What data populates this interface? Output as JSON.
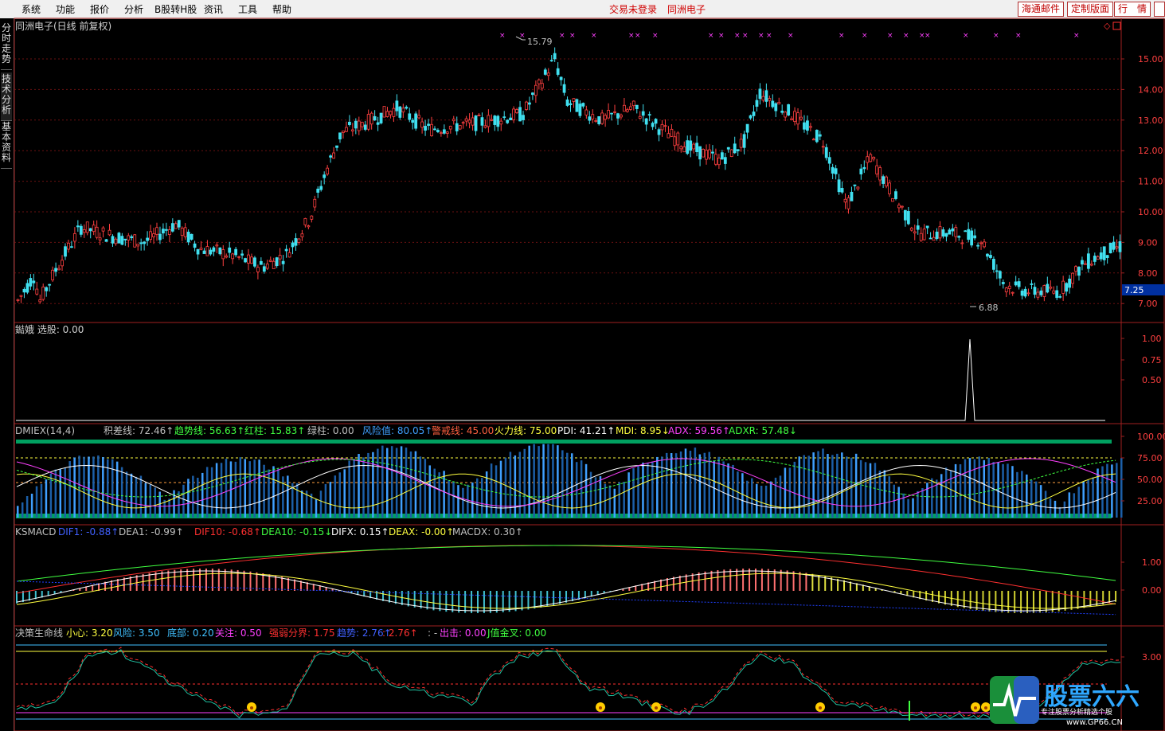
{
  "menu": [
    "系统",
    "功能",
    "报价",
    "分析",
    "B股转H股",
    "资讯",
    "工具",
    "帮助"
  ],
  "status": {
    "login": "交易未登录",
    "stock": "同洲电子"
  },
  "toolbar_buttons": [
    "海通邮件",
    "定制版面",
    "行　情"
  ],
  "side_tabs": [
    "分时走势",
    "技术分析",
    "基本资料"
  ],
  "price_panel": {
    "title": "同洲电子(日线 前复权)",
    "y_ticks": [
      "15.00",
      "14.00",
      "13.00",
      "12.00",
      "11.00",
      "10.00",
      "9.00",
      "8.00",
      "7.00"
    ],
    "high_label": "15.79",
    "low_label": "6.88",
    "current_price": "7.25"
  },
  "signal_panel": {
    "title": "鐑娥 选股: 0.00",
    "y_ticks": [
      "1.00",
      "0.75",
      "0.50"
    ]
  },
  "dmi_panel": {
    "header": [
      {
        "text": "DMIEX(14,4)",
        "color": "#c0c0c0"
      },
      {
        "text": "积差线: 72.46↑",
        "color": "#c0c0c0"
      },
      {
        "text": "趋势线: 56.63↑",
        "color": "#40ff40"
      },
      {
        "text": "红柱: 15.83↑",
        "color": "#40ff40"
      },
      {
        "text": "绿柱: 0.00",
        "color": "#c0c0c0"
      },
      {
        "text": "风险值: 80.05↑",
        "color": "#40a0ff"
      },
      {
        "text": "警戒线: 45.00",
        "color": "#ff6040"
      },
      {
        "text": "火力线: 75.00",
        "color": "#ffff40"
      },
      {
        "text": "PDI: 41.21↑",
        "color": "#ffffff"
      },
      {
        "text": "MDI: 8.95↓",
        "color": "#ffff40"
      },
      {
        "text": "ADX: 59.56↑",
        "color": "#ff40ff"
      },
      {
        "text": "ADXR: 57.48↓",
        "color": "#40ff40"
      }
    ],
    "y_ticks": [
      "100.00",
      "75.00",
      "50.00",
      "25.00"
    ]
  },
  "macd_panel": {
    "header": [
      {
        "text": "KSMACD",
        "color": "#c0c0c0"
      },
      {
        "text": "DIF1: -0.88↑",
        "color": "#4060ff"
      },
      {
        "text": "DEA1: -0.99↑",
        "color": "#c0c0c0"
      },
      {
        "text": "DIF10: -0.68↑",
        "color": "#ff3030"
      },
      {
        "text": "DEA10: -0.15↓",
        "color": "#40ff40"
      },
      {
        "text": "DIFX: 0.15↑",
        "color": "#ffffff"
      },
      {
        "text": "DEAX: -0.00↑",
        "color": "#ffff40"
      },
      {
        "text": "MACDX: 0.30↑",
        "color": "#c0c0c0"
      }
    ],
    "y_ticks": [
      "1.00",
      "0.00"
    ]
  },
  "life_panel": {
    "header": [
      {
        "text": "决策生命线",
        "color": "#c0c0c0"
      },
      {
        "text": "小心: 3.20",
        "color": "#ffff40"
      },
      {
        "text": "风险: 3.50",
        "color": "#40c0ff"
      },
      {
        "text": "底部: 0.20",
        "color": "#40c0ff"
      },
      {
        "text": "关注: 0.50",
        "color": "#ff40ff"
      },
      {
        "text": "强弱分界: 1.75",
        "color": "#ff3030"
      },
      {
        "text": "趋势: 2.76↑",
        "color": "#4060ff"
      },
      {
        "text": ": 2.76↑",
        "color": "#ff3030"
      },
      {
        "text": ": -",
        "color": "#c0c0c0"
      },
      {
        "text": "出击: 0.00",
        "color": "#ff40ff"
      },
      {
        "text": "J值金叉: 0.00",
        "color": "#40ff40"
      }
    ],
    "y_ticks": [
      "3.00"
    ]
  },
  "watermark": {
    "brand": "股票六六",
    "url": "www.GP66.CN",
    "tagline": "专注股票分析精选个股"
  }
}
